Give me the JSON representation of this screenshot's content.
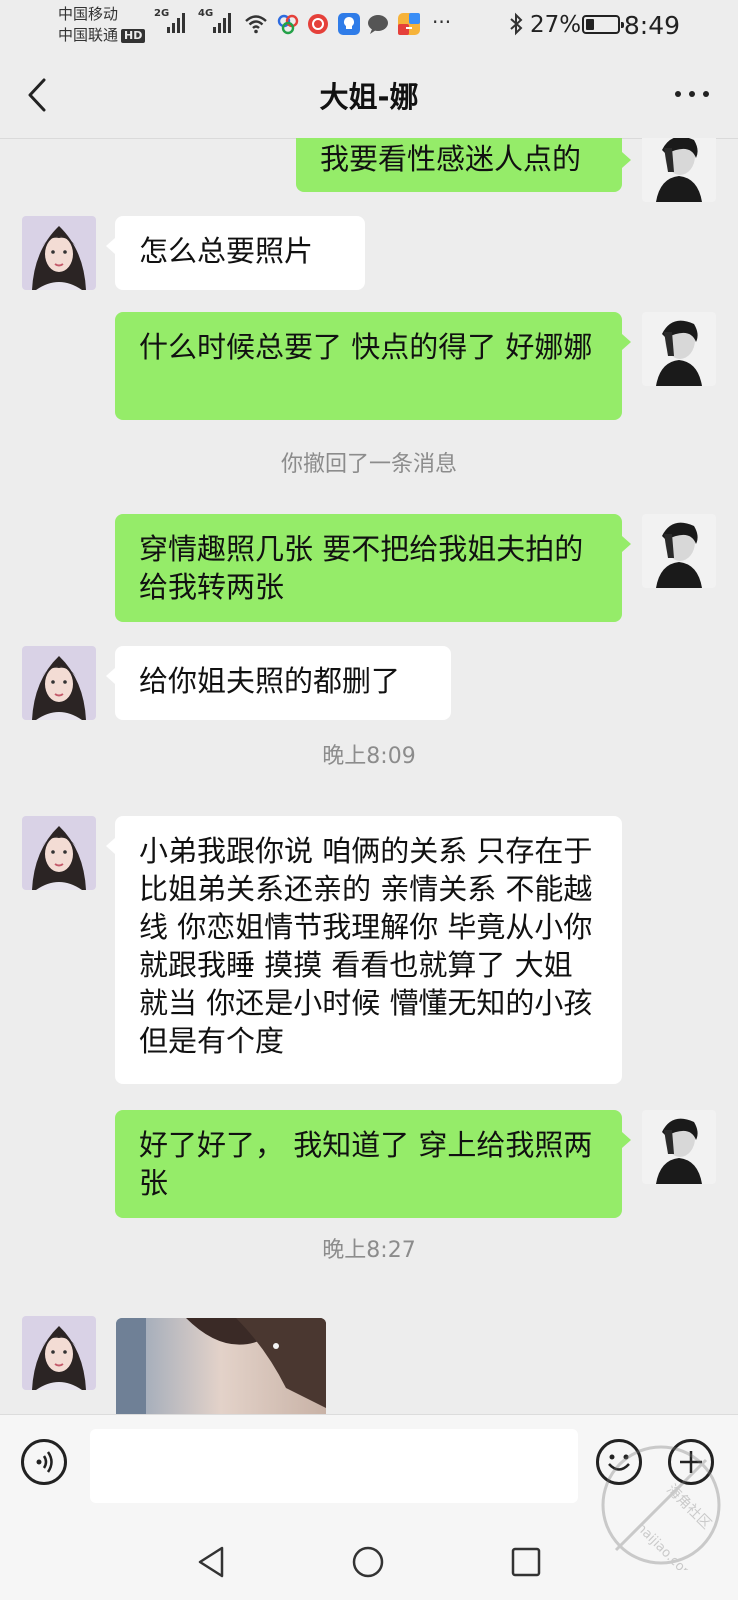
{
  "status_bar": {
    "carrier_1": "中国移动",
    "carrier_2": "中国联通",
    "hd_badge": "HD",
    "net_1": "2G",
    "net_2": "4G",
    "battery_percent": "27%",
    "battery_level": 0.27,
    "time": "8:49",
    "more_dots": "···"
  },
  "header": {
    "title": "大姐-娜",
    "back_icon": "chevron-left-icon",
    "more_icon": "more-dots-icon"
  },
  "messages": [
    {
      "from": "me",
      "text": "我要看性感迷人点的"
    },
    {
      "from": "them",
      "text": "怎么总要照片"
    },
    {
      "from": "me",
      "text": "什么时候总要了  快点的得了  好娜娜"
    },
    {
      "system": "你撤回了一条消息"
    },
    {
      "from": "me",
      "text": "穿情趣照几张  要不把给我姐夫拍的给我转两张"
    },
    {
      "from": "them",
      "text": "给你姐夫照的都删了"
    },
    {
      "system": "晚上8:09"
    },
    {
      "from": "them",
      "text": "小弟我跟你说  咱俩的关系  只存在于  比姐弟关系还亲的  亲情关系  不能越线  你恋姐情节我理解你  毕竟从小你就跟我睡   摸摸  看看也就算了  大姐就当  你还是小时候  懵懂无知的小孩  但是有个度"
    },
    {
      "from": "me",
      "text": "好了好了，  我知道了  穿上给我照两张"
    },
    {
      "system": "晚上8:27"
    },
    {
      "from": "them",
      "type": "image"
    }
  ],
  "input_bar": {
    "voice_icon": "voice-icon",
    "emoji_icon": "emoji-icon",
    "plus_icon": "plus-icon",
    "input_value": ""
  },
  "nav_bar": {
    "back_icon": "triangle-back-icon",
    "home_icon": "circle-home-icon",
    "recents_icon": "square-recents-icon"
  },
  "watermark": {
    "line_1": "海角社区",
    "line_2": "haijiao.com"
  },
  "colors": {
    "background": "#ededed",
    "my_bubble": "#95ec69",
    "their_bubble": "#ffffff",
    "system_text": "#8c8c8c"
  }
}
